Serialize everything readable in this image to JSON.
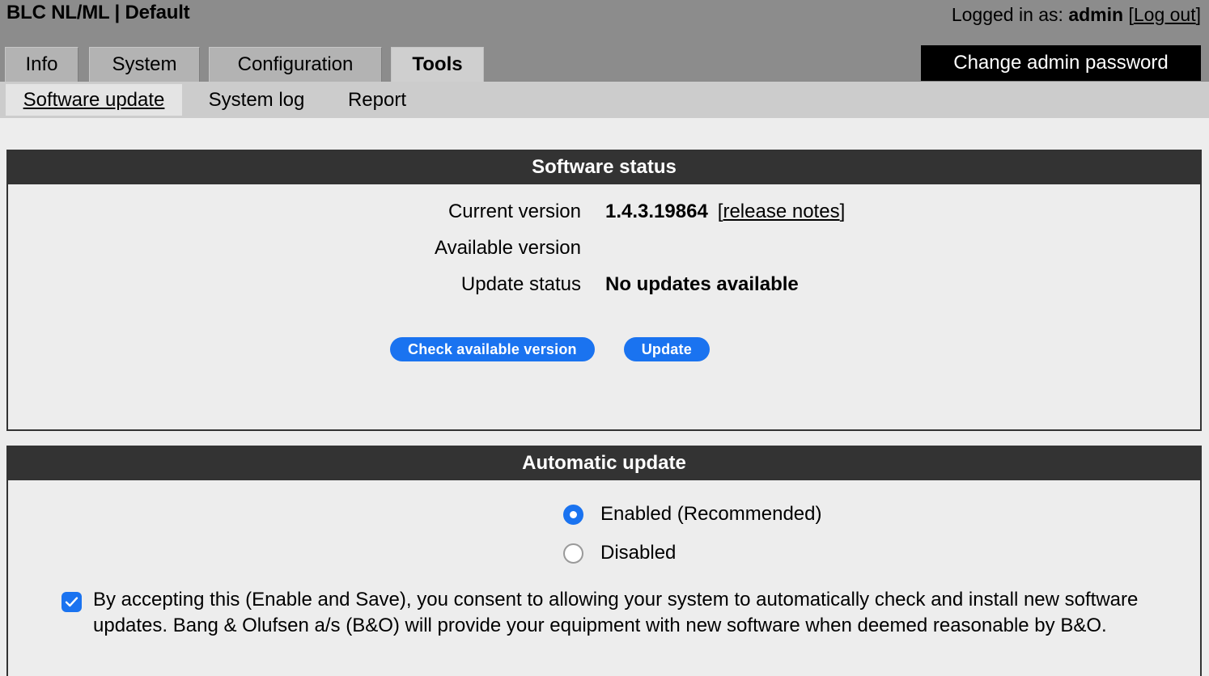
{
  "header": {
    "app_title": "BLC NL/ML | Default",
    "logged_in_prefix": "Logged in as: ",
    "user": "admin",
    "logout_open": " [",
    "logout_label": "Log out",
    "logout_close": "]",
    "change_password_label": "Change admin password"
  },
  "tabs": [
    {
      "label": "Info",
      "active": false
    },
    {
      "label": "System",
      "active": false
    },
    {
      "label": "Configuration",
      "active": false
    },
    {
      "label": "Tools",
      "active": true
    }
  ],
  "subtabs": [
    {
      "label": "Software update",
      "active": true
    },
    {
      "label": "System log",
      "active": false
    },
    {
      "label": "Report",
      "active": false
    }
  ],
  "software_status": {
    "panel_title": "Software status",
    "rows": [
      {
        "label": "Current version",
        "value": "1.4.3.19864",
        "link_open": "[",
        "link_label": "release notes",
        "link_close": "]"
      },
      {
        "label": "Available version",
        "value": ""
      },
      {
        "label": "Update status",
        "value": "No updates available"
      }
    ],
    "check_button_label": "Check available version",
    "update_button_label": "Update"
  },
  "automatic_update": {
    "panel_title": "Automatic update",
    "options": [
      {
        "label": "Enabled (Recommended)",
        "selected": true
      },
      {
        "label": "Disabled",
        "selected": false
      }
    ],
    "consent_checked": true,
    "consent_text": "By accepting this (Enable and Save), you consent to allowing your system to automatically check and install new software updates. Bang & Olufsen a/s (B&O) will provide your equipment with new software when deemed reasonable by B&O."
  },
  "colors": {
    "accent_blue": "#1a73f0",
    "panel_header_bg": "#333333",
    "topbar_bg": "#8c8c8c",
    "subtab_bg": "#cccccc",
    "page_bg": "#ededed"
  }
}
